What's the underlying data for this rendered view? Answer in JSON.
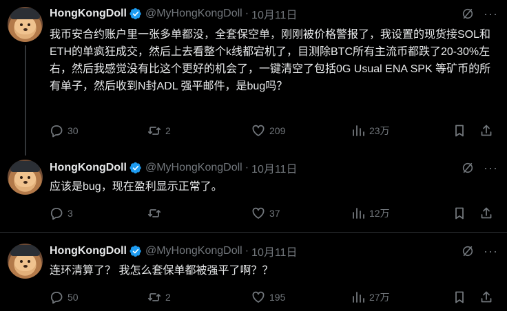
{
  "tweets": [
    {
      "name": "HongKongDoll",
      "handle": "@MyHongKongDoll",
      "dot": "·",
      "date": "10月11日",
      "more": "···",
      "text": "我币安合约账户里一张多单都没，全套保空单，刚刚被价格警报了，我设置的现货接SOL和ETH的单疯狂成交，然后上去看整个k线都宕机了，目测除BTC所有主流币都跌了20-30%左右，然后我感觉没有比这个更好的机会了，一键清空了包括0G Usual ENA SPK 等矿币的所有单子，然后收到N封ADL 强平邮件，是bug吗？",
      "replies": "30",
      "retweets": "2",
      "likes": "209",
      "views": "23万"
    },
    {
      "name": "HongKongDoll",
      "handle": "@MyHongKongDoll",
      "dot": "·",
      "date": "10月11日",
      "more": "···",
      "text": "应该是bug，现在盈利显示正常了。",
      "replies": "3",
      "retweets": "",
      "likes": "37",
      "views": "12万"
    },
    {
      "name": "HongKongDoll",
      "handle": "@MyHongKongDoll",
      "dot": "·",
      "date": "10月11日",
      "more": "···",
      "text": "连环清算了？ 我怎么套保单都被强平了啊？？",
      "replies": "50",
      "retweets": "2",
      "likes": "195",
      "views": "27万"
    }
  ],
  "icons": {
    "verified": "verified-badge-icon",
    "grok": "grok-icon",
    "reply": "reply-icon",
    "retweet": "retweet-icon",
    "like": "heart-icon",
    "views": "views-icon",
    "bookmark": "bookmark-icon",
    "share": "share-icon"
  },
  "colors": {
    "background": "#000000",
    "text": "#e7e9ea",
    "muted": "#71767b",
    "verified": "#1d9bf0",
    "separator": "#2f3336"
  }
}
